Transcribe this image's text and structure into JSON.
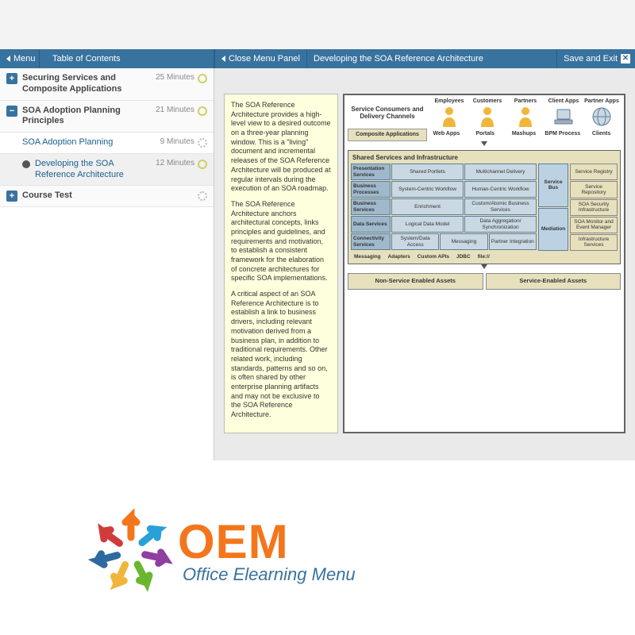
{
  "topbar": {
    "menu": "Menu",
    "toc": "Table of Contents",
    "close_panel": "Close Menu Panel",
    "lesson_title": "Developing the SOA Reference Architecture",
    "save_exit": "Save and Exit"
  },
  "sidebar": {
    "items": [
      {
        "type": "section",
        "toggle": "+",
        "label": "Securing Services and Composite Applications",
        "time": "25 Minutes",
        "status": "clock"
      },
      {
        "type": "section",
        "toggle": "−",
        "label": "SOA Adoption Planning Principles",
        "time": "21 Minutes",
        "status": "clock"
      },
      {
        "type": "sub",
        "label": "SOA Adoption Planning",
        "time": "9 Minutes",
        "status": "spin"
      },
      {
        "type": "sub-playing",
        "label": "Developing the SOA Reference Architecture",
        "time": "12 Minutes",
        "status": "clock"
      },
      {
        "type": "section",
        "toggle": "+",
        "label": "Course Test",
        "time": "",
        "status": "spin"
      }
    ]
  },
  "content": {
    "description": {
      "p1": "The SOA Reference Architecture provides a high-level view to a desired outcome on a three-year planning window. This is a \"living\" document and incremental releases of the SOA Reference Architecture will be produced at regular intervals during the execution of an SOA roadmap.",
      "p2": "The SOA Reference Architecture anchors architectural concepts, links principles and guidelines, and requirements and motivation, to establish a consistent framework for the elaboration of concrete architectures for specific SOA implementations.",
      "p3": "A critical aspect of an SOA Reference Architecture is to establish a link to business drivers, including relevant motivation derived from a business plan, in addition to traditional requirements. Other related work, including standards, patterns and so on, is often shared by other enterprise planning artifacts and may not be exclusive to the SOA Reference Architecture."
    },
    "diagram": {
      "consumers_label": "Service Consumers and Delivery Channels",
      "consumers": [
        {
          "label": "Employees"
        },
        {
          "label": "Customers"
        },
        {
          "label": "Partners"
        },
        {
          "label": "Client Apps"
        },
        {
          "label": "Partner Apps"
        }
      ],
      "composite_apps_header": "Composite Applications",
      "composite_apps": [
        "Web Apps",
        "Portals",
        "Mashups",
        "BPM Process",
        "Clients"
      ],
      "shared_title": "Shared Services and Infrastructure",
      "layers": [
        {
          "name": "Presentation Services",
          "cells": [
            "Shared Portlets",
            "Multichannel Delivery"
          ]
        },
        {
          "name": "Business Processes",
          "cells": [
            "System-Centric Workflow",
            "Human-Centric Workflow"
          ]
        },
        {
          "name": "Business Services",
          "cells": [
            "Enrichment",
            "Custom/Atomic Business Services"
          ]
        },
        {
          "name": "Data Services",
          "cells": [
            "Logical Data Model",
            "Data Aggregation/ Synchronization"
          ]
        },
        {
          "name": "Connectivity Services",
          "cells": [
            "System/Data Access",
            "Messaging",
            "Partner Integration"
          ]
        }
      ],
      "mid_column": [
        "Service Bus",
        "Mediation"
      ],
      "right_column": [
        "Service Registry",
        "Service Repository",
        "SOA Security Infrastructure",
        "SOA Monitor and Event Manager",
        "Infrastructure Services"
      ],
      "protocols": [
        "Messaging",
        "Adapters",
        "Custom APIs",
        "JDBC",
        "file://"
      ],
      "assets": [
        "Non-Service Enabled Assets",
        "Service-Enabled Assets"
      ]
    }
  },
  "footer": {
    "brand": "OEM",
    "tagline": "Office Elearning Menu"
  }
}
